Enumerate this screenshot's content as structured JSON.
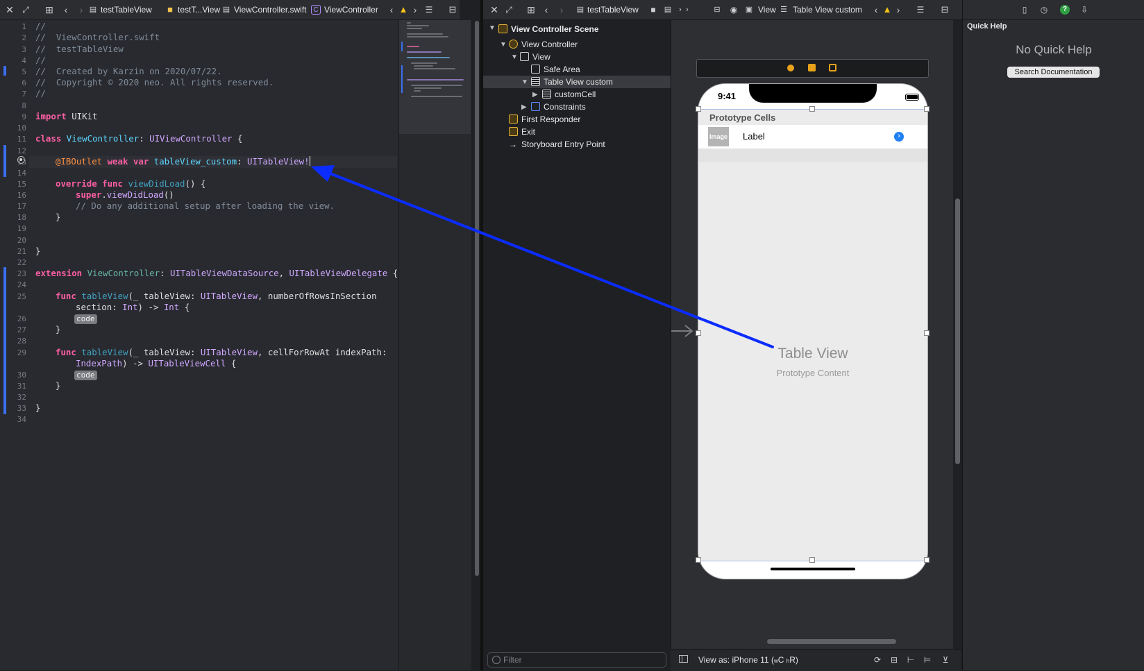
{
  "editor": {
    "breadcrumb": {
      "project": "testTableView",
      "folder": "testT...View",
      "file": "ViewController.swift",
      "symbol": "ViewController",
      "symbol_badge": "C"
    },
    "code_badge": "code",
    "line_numbers": [
      "1",
      "2",
      "3",
      "4",
      "5",
      "6",
      "7",
      "8",
      "9",
      "10",
      "11",
      "12",
      "13",
      "14",
      "15",
      "16",
      "17",
      "18",
      "19",
      "20",
      "21",
      "22",
      "23",
      "24",
      "25",
      "",
      "26",
      "27",
      "28",
      "29",
      "",
      "30",
      "31",
      "32",
      "33",
      "34"
    ],
    "lines": {
      "l1": "//",
      "l2": "//  ViewController.swift",
      "l3": "//  testTableView",
      "l4": "//",
      "l5": "//  Created by Karzin on 2020/07/22.",
      "l6": "//  Copyright © 2020 neo. All rights reserved.",
      "l7": "//",
      "l9_kw": "import",
      "l9_rest": " UIKit",
      "l11_kw": "class",
      "l11_name": "ViewController",
      "l11_colon": ": ",
      "l11_type": "UIViewController",
      "l11_end": " {",
      "l13_attr": "@IBOutlet",
      "l13_kw": " weak var ",
      "l13_name": "tableView_custom",
      "l13_colon": ": ",
      "l13_type": "UITableView!",
      "l15_kw": "override func ",
      "l15_name": "viewDidLoad",
      "l15_end": "() {",
      "l16_kw": "super",
      "l16_dot": ".",
      "l16_name": "viewDidLoad",
      "l16_end": "()",
      "l17": "// Do any additional setup after loading the view.",
      "l18": "}",
      "l21": "}",
      "l23_kw": "extension",
      "l23_name": " ViewController",
      "l23_colon": ": ",
      "l23_t1": "UITableViewDataSource",
      "l23_comma": ", ",
      "l23_t2": "UITableViewDelegate",
      "l23_end": " {",
      "l25_kw": "func ",
      "l25_name": "tableView",
      "l25_a": "(_ tableView: ",
      "l25_t": "UITableView",
      "l25_b": ", numberOfRowsInSection",
      "l25b_a": "section: ",
      "l25b_t": "Int",
      "l25b_b": ") -> ",
      "l25b_t2": "Int",
      "l25b_c": " {",
      "l27": "}",
      "l29_kw": "func ",
      "l29_name": "tableView",
      "l29_a": "(_ tableView: ",
      "l29_t": "UITableView",
      "l29_b": ", cellForRowAt indexPath:",
      "l29b_t": "IndexPath",
      "l29b_a": ") -> ",
      "l29b_t2": "UITableViewCell",
      "l29b_b": " {",
      "l31": "}",
      "l33": "}"
    }
  },
  "outline": {
    "scene": "View Controller Scene",
    "view_controller": "View Controller",
    "view": "View",
    "safe_area": "Safe Area",
    "table_view": "Table View custom",
    "custom_cell": "customCell",
    "constraints": "Constraints",
    "first_responder": "First Responder",
    "exit": "Exit",
    "entry_point": "Storyboard Entry Point",
    "filter_placeholder": "Filter"
  },
  "canvas_bar": {
    "project": "testTableView",
    "view": "View",
    "table": "Table View custom"
  },
  "canvas": {
    "time": "9:41",
    "prototype_cells": "Prototype Cells",
    "image_text": "Image",
    "cell_label": "Label",
    "table_view_title": "Table View",
    "table_view_subtitle": "Prototype Content",
    "view_as": "View as: iPhone 11 (",
    "view_as_w": "w",
    "view_as_c": "C ",
    "view_as_h": "h",
    "view_as_r": "R)"
  },
  "inspector": {
    "title": "Quick Help",
    "empty": "No Quick Help",
    "search_button": "Search Documentation"
  },
  "colors": {
    "accent": "#0b2cff",
    "selection": "#3a3b40",
    "change_bar": "#3a6ff0"
  }
}
